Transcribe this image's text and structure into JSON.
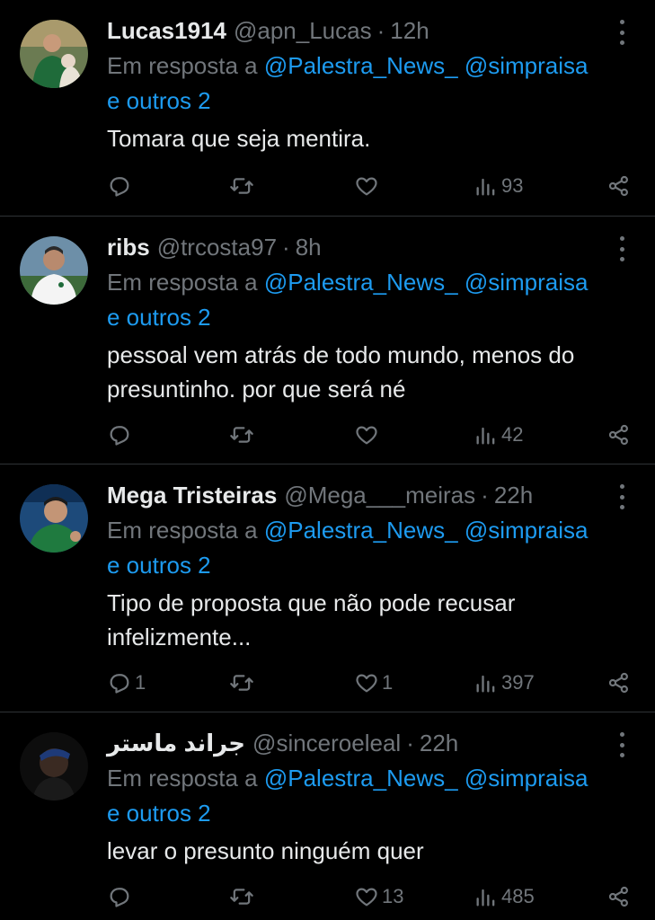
{
  "tweets": [
    {
      "name": "Lucas1914",
      "handle": "@apn_Lucas",
      "dot": "·",
      "time": "12h",
      "reply_prefix": "Em resposta a ",
      "mention1": "@Palestra_News_",
      "mention2": "@simpraisa",
      "others": "e outros 2",
      "text_lines": [
        "Tomara que seja mentira."
      ],
      "replies": "",
      "retweets": "",
      "likes": "",
      "views": "93"
    },
    {
      "name": "ribs",
      "handle": "@trcosta97",
      "dot": "·",
      "time": "8h",
      "reply_prefix": "Em resposta a ",
      "mention1": "@Palestra_News_",
      "mention2": "@simpraisa",
      "others": "e outros 2",
      "text_lines": [
        "pessoal vem atrás de todo mundo, menos do",
        "presuntinho. por que será né"
      ],
      "replies": "",
      "retweets": "",
      "likes": "",
      "views": "42"
    },
    {
      "name": "Mega Tristeiras",
      "handle": "@Mega___meiras",
      "dot": "·",
      "time": "22h",
      "reply_prefix": "Em resposta a ",
      "mention1": "@Palestra_News_",
      "mention2": "@simpraisa",
      "others": "e outros 2",
      "text_lines": [
        "Tipo de proposta que não pode recusar",
        "infelizmente..."
      ],
      "replies": "1",
      "retweets": "",
      "likes": "1",
      "views": "397"
    },
    {
      "name": "جراند ماستر",
      "handle": "@sinceroeleal",
      "dot": "·",
      "time": "22h",
      "reply_prefix": "Em resposta a ",
      "mention1": "@Palestra_News_",
      "mention2": "@simpraisa",
      "others": "e outros 2",
      "text_lines": [
        "levar o presunto ninguém quer"
      ],
      "replies": "",
      "retweets": "",
      "likes": "13",
      "views": "485"
    }
  ],
  "icons": {
    "reply": "reply-icon",
    "retweet": "retweet-icon",
    "like": "heart-icon",
    "views": "views-icon",
    "share": "share-icon",
    "more": "more-icon"
  },
  "colors": {
    "background": "#000000",
    "text": "#e7e9ea",
    "muted": "#71767b",
    "link": "#1d9bf0",
    "divider": "#2f3336"
  }
}
